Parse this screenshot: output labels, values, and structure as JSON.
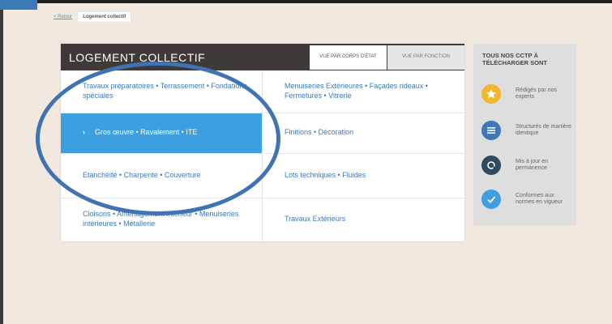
{
  "breadcrumb": {
    "back": "< Retour",
    "current": "Logement collectif"
  },
  "panel": {
    "title": "LOGEMENT COLLECTIF",
    "tabs": [
      {
        "label": "VUE PAR CORPS D'ÉTAT",
        "active": true
      },
      {
        "label": "VUE PAR FONCTION",
        "active": false
      }
    ],
    "left": [
      {
        "label": "Travaux préparatoires • Terrassement • Fondations spéciales"
      },
      {
        "label": "Gros œuvre • Ravalement • ITE",
        "selected": true
      },
      {
        "label": "Etanchéité • Charpente • Couverture"
      },
      {
        "label": "Cloisons • Aménagement intérieur • Menuiseries intérieures • Métallerie"
      }
    ],
    "right": [
      {
        "label": "Menuiseries Extérieures • Façades rideaux • Fermetures • Vitrerie"
      },
      {
        "label": "Finitions • Décoration"
      },
      {
        "label": "Lots techniques • Fluides"
      },
      {
        "label": "Travaux Extérieurs"
      }
    ]
  },
  "sidebar": {
    "title": "TOUS NOS CCTP À TÉLÉCHARGER SONT",
    "features": [
      {
        "icon": "star-badge-icon",
        "color": "#f2b52b",
        "label": "Rédigés par nos experts"
      },
      {
        "icon": "list-icon",
        "color": "#3d78b7",
        "label": "Structurés de manière identique"
      },
      {
        "icon": "refresh-icon",
        "color": "#2f4b5e",
        "label": "Mis à jour en permanence"
      },
      {
        "icon": "check-icon",
        "color": "#3d9fdf",
        "label": "Conformes aux normes en vigueur"
      }
    ]
  },
  "colors": {
    "accent": "#3d78b7",
    "selected": "#3d9fdf",
    "header": "#3f3a37",
    "highlight_ring": "#3f73b3"
  }
}
